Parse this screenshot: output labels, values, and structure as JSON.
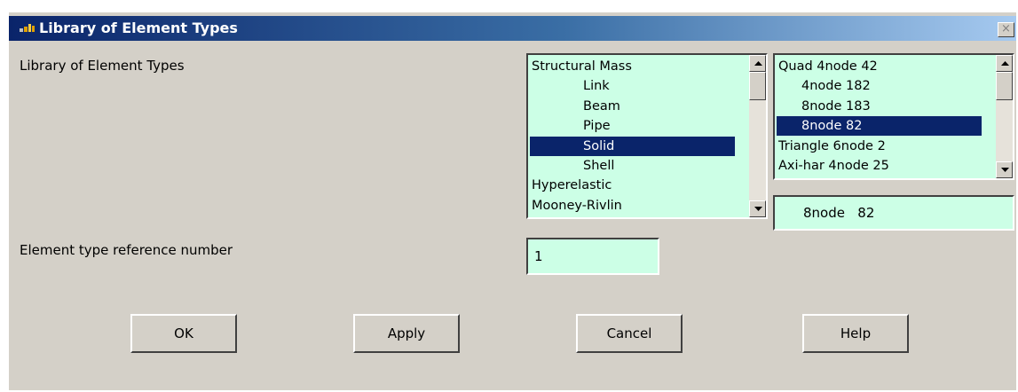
{
  "window": {
    "title": "Library of Element Types",
    "close_glyph": "×"
  },
  "form": {
    "library_label": "Library of Element Types",
    "ref_label": "Element type reference number",
    "ref_value": "1"
  },
  "category_list": {
    "items": [
      {
        "label": "Structural Mass",
        "indent": false,
        "selected": false
      },
      {
        "label": "Link",
        "indent": true,
        "selected": false
      },
      {
        "label": "Beam",
        "indent": true,
        "selected": false
      },
      {
        "label": "Pipe",
        "indent": true,
        "selected": false
      },
      {
        "label": "Solid",
        "indent": true,
        "selected": true
      },
      {
        "label": "Shell",
        "indent": true,
        "selected": false
      },
      {
        "label": "Hyperelastic",
        "indent": false,
        "selected": false
      },
      {
        "label": "Mooney-Rivlin",
        "indent": false,
        "selected": false
      }
    ]
  },
  "type_list": {
    "items": [
      {
        "label": "Quad 4node   42",
        "indent": false,
        "selected": false
      },
      {
        "label": "4node  182",
        "indent": true,
        "selected": false
      },
      {
        "label": "8node  183",
        "indent": true,
        "selected": false
      },
      {
        "label": "8node   82",
        "indent": true,
        "selected": true
      },
      {
        "label": "Triangle 6node 2",
        "indent": false,
        "selected": false
      },
      {
        "label": "Axi-har 4node 25",
        "indent": false,
        "selected": false
      }
    ]
  },
  "selected_type": {
    "value": "8node   82"
  },
  "buttons": {
    "ok": "OK",
    "apply": "Apply",
    "cancel": "Cancel",
    "help": "Help"
  },
  "colors": {
    "list_bg": "#ccffe6",
    "selection": "#0a246a",
    "dialog_bg": "#d4d0c8",
    "title_start": "#0a246a",
    "title_end": "#a6caf0"
  },
  "icons": {
    "app": "ansys-app-icon",
    "close": "close-icon",
    "scroll_up": "scroll-up-arrow-icon",
    "scroll_down": "scroll-down-arrow-icon"
  }
}
